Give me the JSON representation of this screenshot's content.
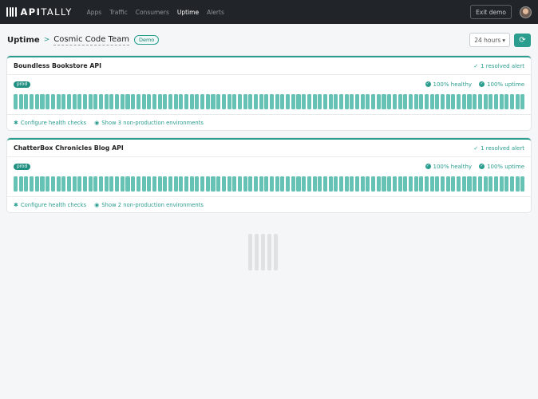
{
  "nav": {
    "brand_bold": "API",
    "brand_light": "TALLY",
    "links": [
      "Apps",
      "Traffic",
      "Consumers",
      "Uptime",
      "Alerts"
    ],
    "active": "Uptime",
    "exit_label": "Exit demo"
  },
  "header": {
    "crumb_root": "Uptime",
    "team": "Cosmic Code Team",
    "badge": "Demo",
    "period": "24 hours"
  },
  "apps": [
    {
      "title": "Boundless Bookstore API",
      "resolved": "1 resolved alert",
      "env": "prod",
      "healthy": "100% healthy",
      "uptime": "100% uptime",
      "configure": "Configure health checks",
      "show_envs": "Show 3 non-production environments"
    },
    {
      "title": "ChatterBox Chronicles Blog API",
      "resolved": "1 resolved alert",
      "env": "prod",
      "healthy": "100% healthy",
      "uptime": "100% uptime",
      "configure": "Configure health checks",
      "show_envs": "Show 2 non-production environments"
    }
  ],
  "colors": {
    "accent": "#2a9d8f",
    "bar": "#66c2b5",
    "nav_bg": "#212529"
  },
  "icons": {
    "resolved": "check-icon",
    "healthy": "check-circle-icon",
    "configure": "gear-icon",
    "show": "eye-icon",
    "refresh": "refresh-icon"
  }
}
